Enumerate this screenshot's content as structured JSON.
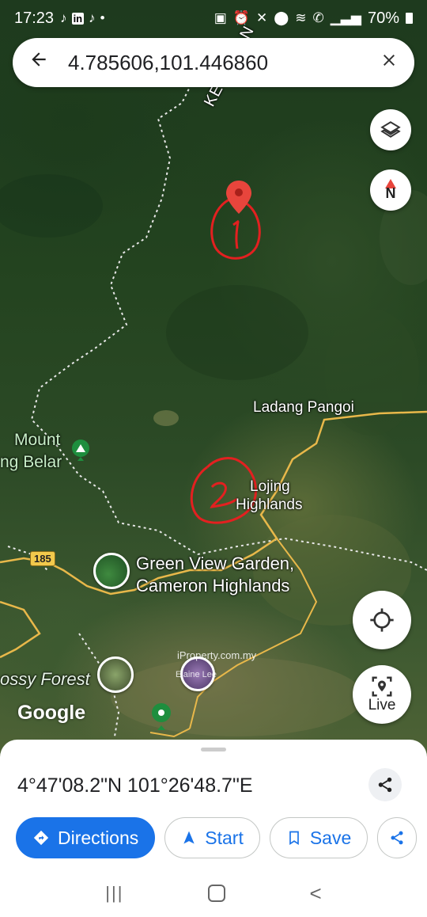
{
  "status_bar": {
    "time": "17:23",
    "app_icons": [
      "tiktok-icon",
      "linkedin-icon",
      "tiktok-icon"
    ],
    "dot": "•",
    "battery": "70%"
  },
  "search": {
    "query": "4.785606,101.446860"
  },
  "map": {
    "road_label": "KELANTAN",
    "places": {
      "ladang_pangoi": "Ladang Pangoi",
      "mount_line1": "Mount",
      "mount_line2": "ng Belar",
      "lojing_line1": "Lojing",
      "lojing_line2": "Highlands",
      "green_view_line1": "Green View Garden,",
      "green_view_line2": "Cameron Highlands",
      "mossy_forest": "ossy Forest"
    },
    "route_number": "185",
    "watermark": "iProperty.com.my",
    "watermark_user": "Elaine Lee",
    "google_logo": "Google",
    "annotations": [
      "1",
      "2"
    ],
    "colors": {
      "pin": "#e8453c",
      "annotation": "#e32020",
      "route": "#e8b84a",
      "poi_green": "#1e8e3e"
    }
  },
  "controls": {
    "compass_label": "N",
    "live_label": "Live"
  },
  "sheet": {
    "coordinates": "4°47'08.2\"N 101°26'48.7\"E",
    "actions": {
      "directions": "Directions",
      "start": "Start",
      "save": "Save"
    },
    "accent": "#1a73e8"
  },
  "nav_bar": {
    "recents": "|||",
    "home": "○",
    "back": "<"
  }
}
